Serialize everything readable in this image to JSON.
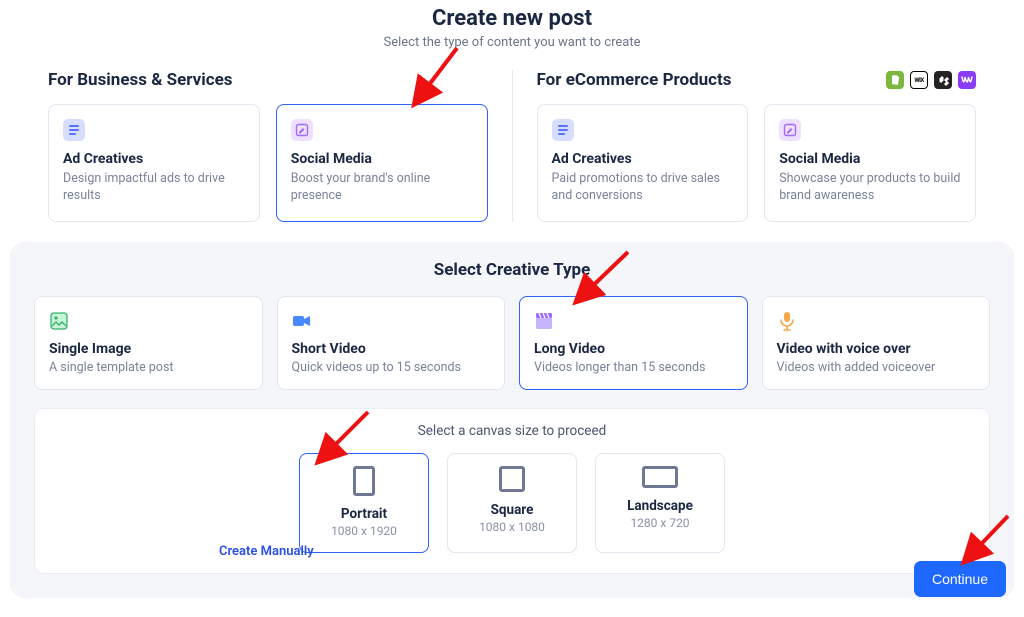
{
  "header": {
    "title": "Create new post",
    "subtitle": "Select the type of content you want to create"
  },
  "sections": {
    "business": {
      "title": "For Business & Services",
      "cards": [
        {
          "title": "Ad Creatives",
          "desc": "Design impactful ads to drive results"
        },
        {
          "title": "Social Media",
          "desc": "Boost your brand's online presence"
        }
      ]
    },
    "ecommerce": {
      "title": "For eCommerce Products",
      "cards": [
        {
          "title": "Ad Creatives",
          "desc": "Paid promotions to drive sales and conversions"
        },
        {
          "title": "Social Media",
          "desc": "Showcase your products to build brand awareness"
        }
      ]
    }
  },
  "creative": {
    "heading": "Select Creative Type",
    "types": [
      {
        "title": "Single Image",
        "desc": "A single template post"
      },
      {
        "title": "Short Video",
        "desc": "Quick videos up to 15 seconds"
      },
      {
        "title": "Long Video",
        "desc": "Videos longer than 15 seconds"
      },
      {
        "title": "Video with voice over",
        "desc": "Videos with added voiceover"
      }
    ]
  },
  "canvas": {
    "heading": "Select a canvas size to proceed",
    "sizes": [
      {
        "title": "Portrait",
        "dim": "1080 x 1920"
      },
      {
        "title": "Square",
        "dim": "1080 x 1080"
      },
      {
        "title": "Landscape",
        "dim": "1280 x 720"
      }
    ],
    "manual_label": "Create Manually"
  },
  "actions": {
    "continue": "Continue"
  },
  "brand_icons": {
    "wix_label": "WIX"
  }
}
